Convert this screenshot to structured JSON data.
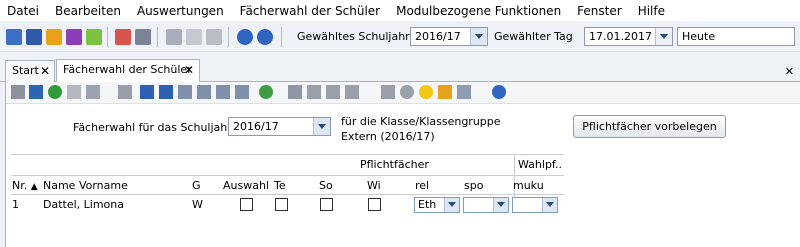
{
  "menu": [
    "Datei",
    "Bearbeiten",
    "Auswertungen",
    "Fächerwahl der Schüler",
    "Modulbezogene Funktionen",
    "Fenster",
    "Hilfe"
  ],
  "toolbar": {
    "schuljahr_label": "Gewähltes Schuljahr",
    "schuljahr_value": "2016/17",
    "tag_label": "Gewählter Tag",
    "tag_value": "17.01.2017",
    "heute_value": "Heute"
  },
  "tabs": [
    {
      "label": "Start"
    },
    {
      "label": "Fächerwahl der Schüler"
    }
  ],
  "form": {
    "schuljahr_label": "Fächerwahl für das Schuljahr",
    "schuljahr_value": "2016/17",
    "klasse_label": "für die Klasse/Klassengruppe",
    "klasse_value": "Extern (2016/17)",
    "pflicht_button": "Pflichtfächer vorbelegen"
  },
  "grid": {
    "group_pflicht": "Pflichtfächer",
    "group_wahl": "Wahlpf..",
    "columns": [
      "Nr.",
      "Name Vorname",
      "G",
      "Auswahl",
      "Te",
      "So",
      "Wi",
      "rel",
      "spo",
      "muku"
    ],
    "rows": [
      {
        "nr": "1",
        "name": "Dattel, Limona",
        "g": "W",
        "rel": "Eth",
        "spo": "",
        "muku": ""
      }
    ]
  }
}
